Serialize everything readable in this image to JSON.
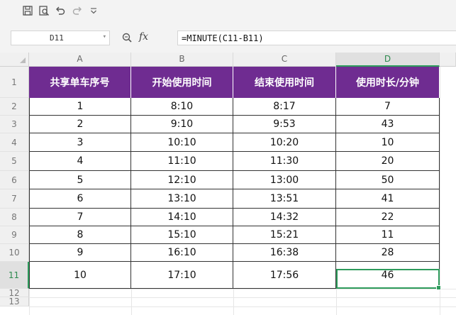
{
  "toolbar": {
    "icons": [
      "save-icon",
      "print-preview-icon",
      "undo-icon",
      "redo-icon",
      "customize-dropdown-icon"
    ]
  },
  "formula_bar": {
    "name_box": "D11",
    "fx_label": "fx",
    "formula": "=MINUTE(C11-B11)"
  },
  "columns": [
    "A",
    "B",
    "C",
    "D"
  ],
  "selected_column": "D",
  "row_numbers": [
    "1",
    "2",
    "3",
    "4",
    "5",
    "6",
    "7",
    "8",
    "9",
    "10",
    "11",
    "12",
    "13"
  ],
  "selected_row": "11",
  "table": {
    "headers": [
      "共享单车序号",
      "开始使用时间",
      "结束使用时间",
      "使用时长/分钟"
    ],
    "rows": [
      [
        "1",
        "8:10",
        "8:17",
        "7"
      ],
      [
        "2",
        "9:10",
        "9:53",
        "43"
      ],
      [
        "3",
        "10:10",
        "10:20",
        "10"
      ],
      [
        "4",
        "11:10",
        "11:30",
        "20"
      ],
      [
        "5",
        "12:10",
        "13:00",
        "50"
      ],
      [
        "6",
        "13:10",
        "13:51",
        "41"
      ],
      [
        "7",
        "14:10",
        "14:32",
        "22"
      ],
      [
        "8",
        "15:10",
        "15:21",
        "11"
      ],
      [
        "9",
        "16:10",
        "16:38",
        "28"
      ],
      [
        "10",
        "17:10",
        "17:56",
        "46"
      ]
    ]
  },
  "colors": {
    "header_fill": "#6f2c91",
    "selection": "#2e9b5c"
  }
}
